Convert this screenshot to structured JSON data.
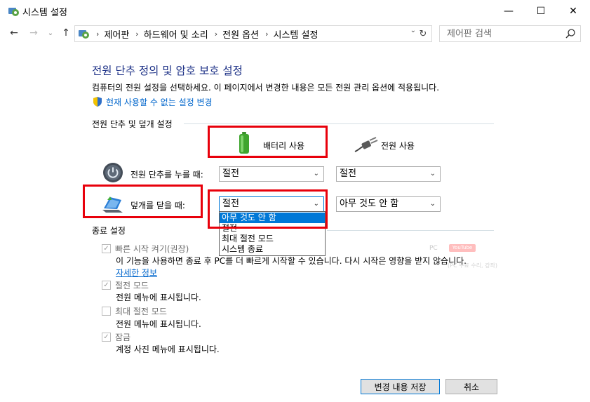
{
  "window": {
    "title": "시스템 설정",
    "minimize_glyph": "—",
    "maximize_glyph": "☐",
    "close_glyph": "✕"
  },
  "nav": {
    "back_glyph": "←",
    "forward_glyph": "→",
    "recent_glyph": "⌄",
    "up_glyph": "↑",
    "breadcrumbs": [
      "제어판",
      "하드웨어 및 소리",
      "전원 옵션",
      "시스템 설정"
    ],
    "separator": "›",
    "refresh_glyph": "↻",
    "dropdown_glyph": "⌄",
    "search_placeholder": "제어판 검색"
  },
  "page": {
    "title": "전원 단추 정의 및 암호 보호 설정",
    "description": "컴퓨터의 전원 설정을 선택하세요. 이 페이지에서 변경한 내용은 모든 전원 관리 옵션에 적용됩니다.",
    "change_link": "현재 사용할 수 없는 설정 변경"
  },
  "power_buttons_section": {
    "heading": "전원 단추 및 덮개 설정",
    "column_battery": "배터리 사용",
    "column_plugged": "전원 사용",
    "rows": [
      {
        "label": "전원 단추를 누를 때:",
        "battery_value": "절전",
        "plugged_value": "절전"
      },
      {
        "label": "덮개를 닫을 때:",
        "battery_value": "절전",
        "plugged_value": "아무 것도 안 함"
      }
    ],
    "open_dropdown_options": [
      "아무 것도 안 함",
      "절전",
      "최대 절전 모드",
      "시스템 종료"
    ],
    "open_dropdown_highlighted_index": 0,
    "chevron_glyph": "⌄"
  },
  "shutdown_section": {
    "heading": "종료 설정",
    "check_glyph": "✓",
    "items": [
      {
        "label": "빠른 시작 켜기(권장)",
        "checked": true,
        "description": "이 기능을 사용하면 종료 후 PC를 더 빠르게 시작할 수 있습니다. 다시 시작은 영향을 받지 않습니다.",
        "link": "자세한 정보"
      },
      {
        "label": "절전 모드",
        "checked": true,
        "description": "전원 메뉴에 표시됩니다."
      },
      {
        "label": "최대 절전 모드",
        "checked": false,
        "description": "전원 메뉴에 표시됩니다."
      },
      {
        "label": "잠금",
        "checked": true,
        "description": "계정 사진 메뉴에 표시됩니다."
      }
    ]
  },
  "watermark": {
    "pc": "PC",
    "youtube": "YouTube",
    "caption": "(PC 무료 수리, 강좌)"
  },
  "footer": {
    "save_label": "변경 내용 저장",
    "cancel_label": "취소"
  },
  "colors": {
    "title_blue": "#1e3287",
    "link_blue": "#0066cc",
    "highlight": "#e8000b",
    "selection": "#0078d7"
  }
}
